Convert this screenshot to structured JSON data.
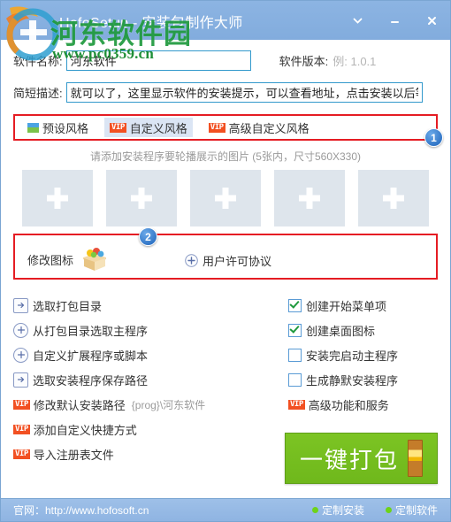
{
  "window": {
    "title": "HofoSetup - 安装包制作大师",
    "controls": [
      {
        "name": "chevron-down-icon",
        "label": "⌄"
      },
      {
        "name": "minimize-icon",
        "label": "—"
      },
      {
        "name": "close-icon",
        "label": "✕"
      }
    ]
  },
  "watermark": {
    "text": "河东软件园",
    "url": "www.pc0359.cn"
  },
  "form": {
    "name_label": "软件名称:",
    "name_value": "河东软件",
    "name_placeholder": "",
    "version_label": "软件版本:",
    "version_value": "",
    "version_placeholder": "例: 1.0.1",
    "desc_label": "简短描述:",
    "desc_value": "就可以了，这里显示软件的安装提示，可以查看地址，点击安装以后等待十",
    "desc_placeholder": ""
  },
  "style_tabs": [
    {
      "label": "预设风格",
      "vip": false,
      "active": false
    },
    {
      "label": "自定义风格",
      "vip": true,
      "active": true
    },
    {
      "label": "高级自定义风格",
      "vip": true,
      "active": false
    }
  ],
  "gallery": {
    "hint": "请添加安装程序要轮播展示的图片  (5张内，尺寸560X330)",
    "slots": [
      "+",
      "+",
      "+",
      "+",
      "+"
    ]
  },
  "icon_row": {
    "edit_icon_label": "修改图标",
    "license_label": "用户许可协议"
  },
  "badges": {
    "one": "1",
    "two": "2"
  },
  "options_left": [
    {
      "label": "选取打包目录",
      "icon": "folder-arrow-icon",
      "shape": "square",
      "vip": false,
      "sub": ""
    },
    {
      "label": "从打包目录选取主程序",
      "icon": "plus-circle-icon",
      "shape": "circle",
      "vip": false,
      "sub": ""
    },
    {
      "label": "自定义扩展程序或脚本",
      "icon": "plus-circle-icon",
      "shape": "circle",
      "vip": false,
      "sub": ""
    },
    {
      "label": "选取安装程序保存路径",
      "icon": "folder-arrow-icon",
      "shape": "square",
      "vip": false,
      "sub": ""
    },
    {
      "label": "修改默认安装路径",
      "icon": "vip-badge-icon",
      "shape": "vip",
      "vip": true,
      "sub": "{prog}\\河东软件"
    },
    {
      "label": "添加自定义快捷方式",
      "icon": "vip-badge-icon",
      "shape": "vip",
      "vip": true,
      "sub": ""
    },
    {
      "label": "导入注册表文件",
      "icon": "vip-badge-icon",
      "shape": "vip",
      "vip": true,
      "sub": ""
    }
  ],
  "options_right": [
    {
      "label": "创建开始菜单项",
      "type": "checkbox",
      "checked": true
    },
    {
      "label": "创建桌面图标",
      "type": "checkbox",
      "checked": true
    },
    {
      "label": "安装完启动主程序",
      "type": "checkbox",
      "checked": false
    },
    {
      "label": "生成静默安装程序",
      "type": "checkbox",
      "checked": false
    },
    {
      "label": "高级功能和服务",
      "type": "vip",
      "checked": false
    }
  ],
  "pack_button": {
    "label": "一键打包"
  },
  "statusbar": {
    "site": "官网：http://www.hofosoft.cn",
    "links": [
      "定制安装",
      "定制软件"
    ]
  },
  "colors": {
    "title_bar": "#87b0e0",
    "accent_red": "#e51c23",
    "vip_orange": "#f25022",
    "green_button": "#7cc423",
    "input_border": "#3399cc",
    "watermark_green": "#1f9a3d"
  }
}
